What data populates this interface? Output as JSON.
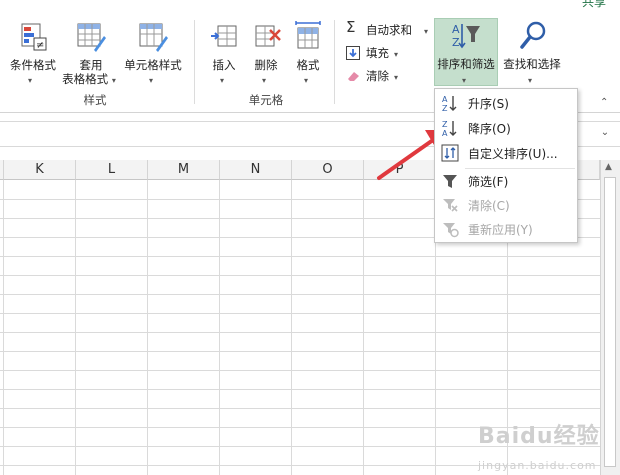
{
  "ribbon": {
    "share_label": "共享",
    "styles_group": {
      "label": "样式",
      "conditional_format": "条件格式",
      "table_format_line1": "套用",
      "table_format_line2": "表格格式",
      "cell_styles": "单元格样式"
    },
    "cells_group": {
      "label": "单元格",
      "insert": "插入",
      "delete": "删除",
      "format": "格式"
    },
    "editing_group": {
      "autosum": "自动求和",
      "fill": "填充",
      "clear": "清除",
      "sort_filter": "排序和筛选",
      "find_select": "查找和选择"
    }
  },
  "sheet": {
    "columns": [
      "K",
      "L",
      "M",
      "N",
      "O",
      "P"
    ]
  },
  "sort_menu": {
    "items": [
      {
        "label": "升序(S)",
        "enabled": true
      },
      {
        "label": "降序(O)",
        "enabled": true
      },
      {
        "label": "自定义排序(U)...",
        "enabled": true
      },
      {
        "label": "筛选(F)",
        "enabled": true
      },
      {
        "label": "清除(C)",
        "enabled": false
      },
      {
        "label": "重新应用(Y)",
        "enabled": false
      }
    ]
  },
  "watermark": {
    "text": "Baidu经验",
    "sub": "jingyan.baidu.com"
  },
  "colors": {
    "accent_green": "#217346",
    "arrow_red": "#e0393e",
    "highlight": "#c5dfcd"
  }
}
